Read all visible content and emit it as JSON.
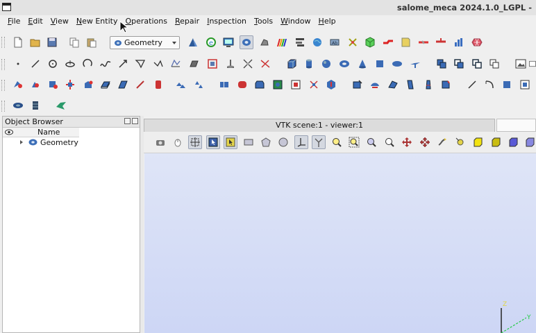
{
  "window": {
    "title": "salome_meca 2024.1.0_LGPL -"
  },
  "menu": [
    "File",
    "Edit",
    "View",
    "New Entity",
    "Operations",
    "Repair",
    "Inspection",
    "Tools",
    "Window",
    "Help"
  ],
  "module_selector": {
    "value": "Geometry",
    "icon": "geometry-module-icon"
  },
  "object_browser": {
    "title": "Object Browser",
    "column": "Name",
    "items": [
      {
        "label": "Geometry",
        "icon": "geometry-component-icon"
      }
    ]
  },
  "viewer": {
    "tab_title": "VTK scene:1 - viewer:1"
  },
  "axes": {
    "z_label": "Z",
    "y_label": "Y"
  },
  "colors": {
    "viewport_top": "#dfe5f7",
    "viewport_bottom": "#cdd6f5",
    "axis_z": "#e0d640",
    "axis_y": "#22cc44"
  }
}
